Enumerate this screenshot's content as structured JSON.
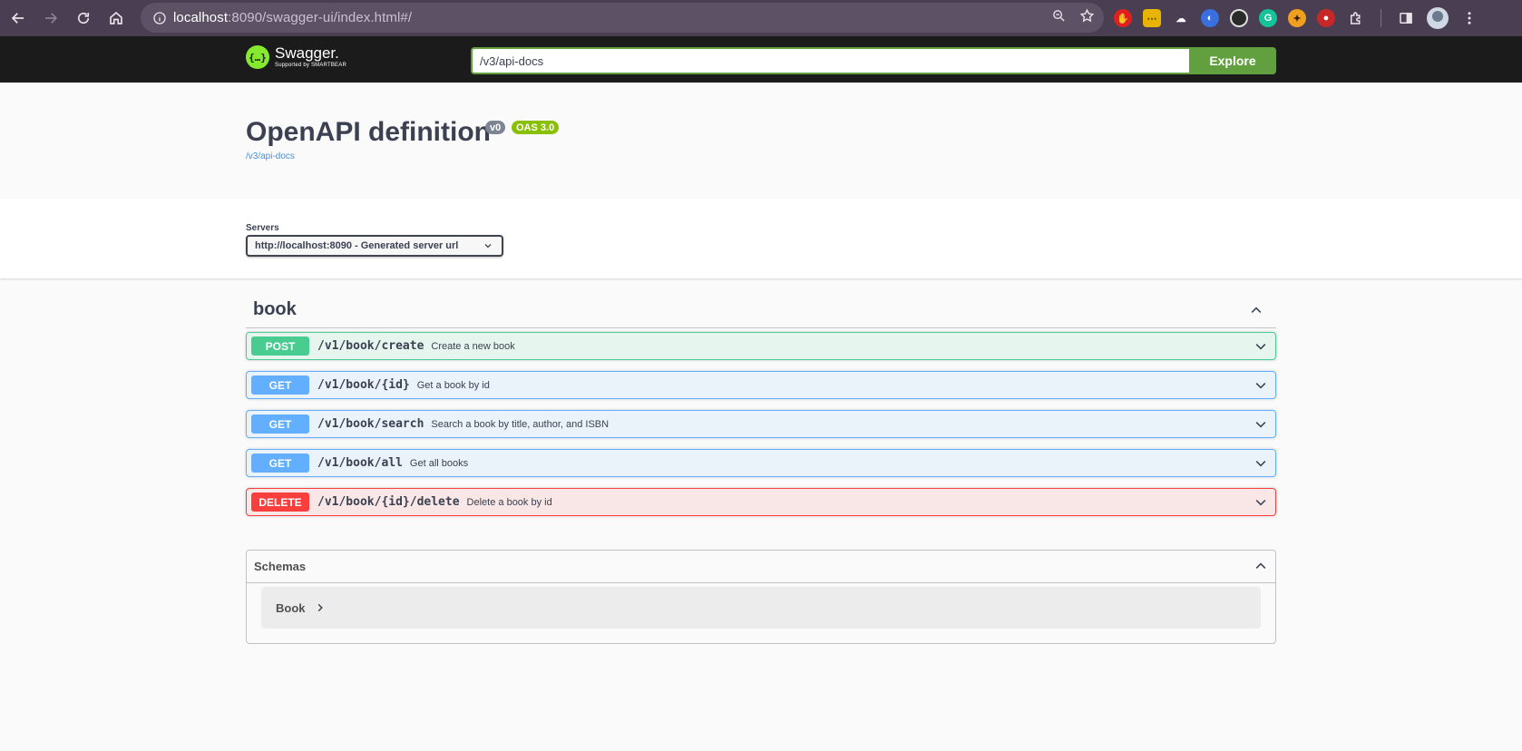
{
  "browser": {
    "url_host": "localhost",
    "url_rest": ":8090/swagger-ui/index.html#/"
  },
  "topbar": {
    "logo_name": "Swagger.",
    "logo_sub": "Supported by SMARTBEAR",
    "explore_value": "/v3/api-docs",
    "explore_label": "Explore"
  },
  "info": {
    "title": "OpenAPI definition",
    "version_badge": "v0",
    "oas_badge": "OAS 3.0",
    "spec_link": "/v3/api-docs"
  },
  "servers": {
    "label": "Servers",
    "selected": "http://localhost:8090 - Generated server url"
  },
  "tag": {
    "name": "book"
  },
  "operations": [
    {
      "method": "POST",
      "path": "/v1/book/create",
      "summary": "Create a new book"
    },
    {
      "method": "GET",
      "path": "/v1/book/{id}",
      "summary": "Get a book by id"
    },
    {
      "method": "GET",
      "path": "/v1/book/search",
      "summary": "Search a book by title, author, and ISBN"
    },
    {
      "method": "GET",
      "path": "/v1/book/all",
      "summary": "Get all books"
    },
    {
      "method": "DELETE",
      "path": "/v1/book/{id}/delete",
      "summary": "Delete a book by id"
    }
  ],
  "schemas": {
    "title": "Schemas",
    "items": [
      {
        "name": "Book"
      }
    ]
  },
  "colors": {
    "post": "#49cc90",
    "get": "#61affe",
    "delete": "#f93e3e",
    "explore": "#62a03f",
    "topbar": "#1b1b1b"
  }
}
